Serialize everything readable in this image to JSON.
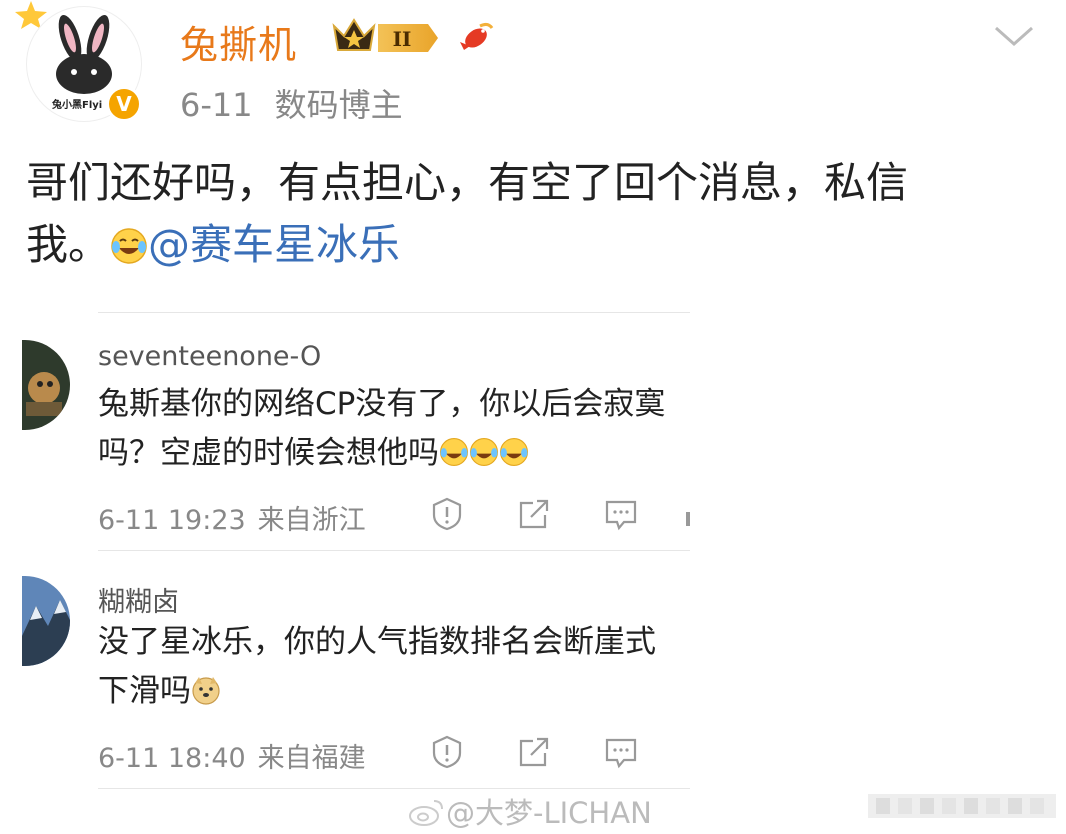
{
  "post": {
    "author": "兔撕机",
    "level_badge": "II",
    "avatar_caption": "兔小黑Flyi",
    "verified_mark": "V",
    "date": "6-11",
    "tag": "数码博主",
    "text_line1": "哥们还好吗，有点担心，有空了回个消息，私信",
    "text_line2": "我。",
    "mention": "@赛车星冰乐"
  },
  "comments": [
    {
      "username": "seventeenone-O",
      "text_line1": "兔斯基你的网络CP没有了，你以后会寂寞",
      "text_line2": "吗？空虚的时候会想他吗",
      "time": "6-11 19:23",
      "location": "来自浙江"
    },
    {
      "username": "糊糊卤",
      "text_line1": "没了星冰乐，你的人气指数排名会断崖式",
      "text_line2": "下滑吗",
      "time": "6-11 18:40",
      "location": "来自福建"
    }
  ],
  "watermark": "@大梦-LICHAN",
  "colors": {
    "author": "#e8791a",
    "mention": "#3a6fb8",
    "verified": "#f5a400",
    "meta": "#888888"
  }
}
